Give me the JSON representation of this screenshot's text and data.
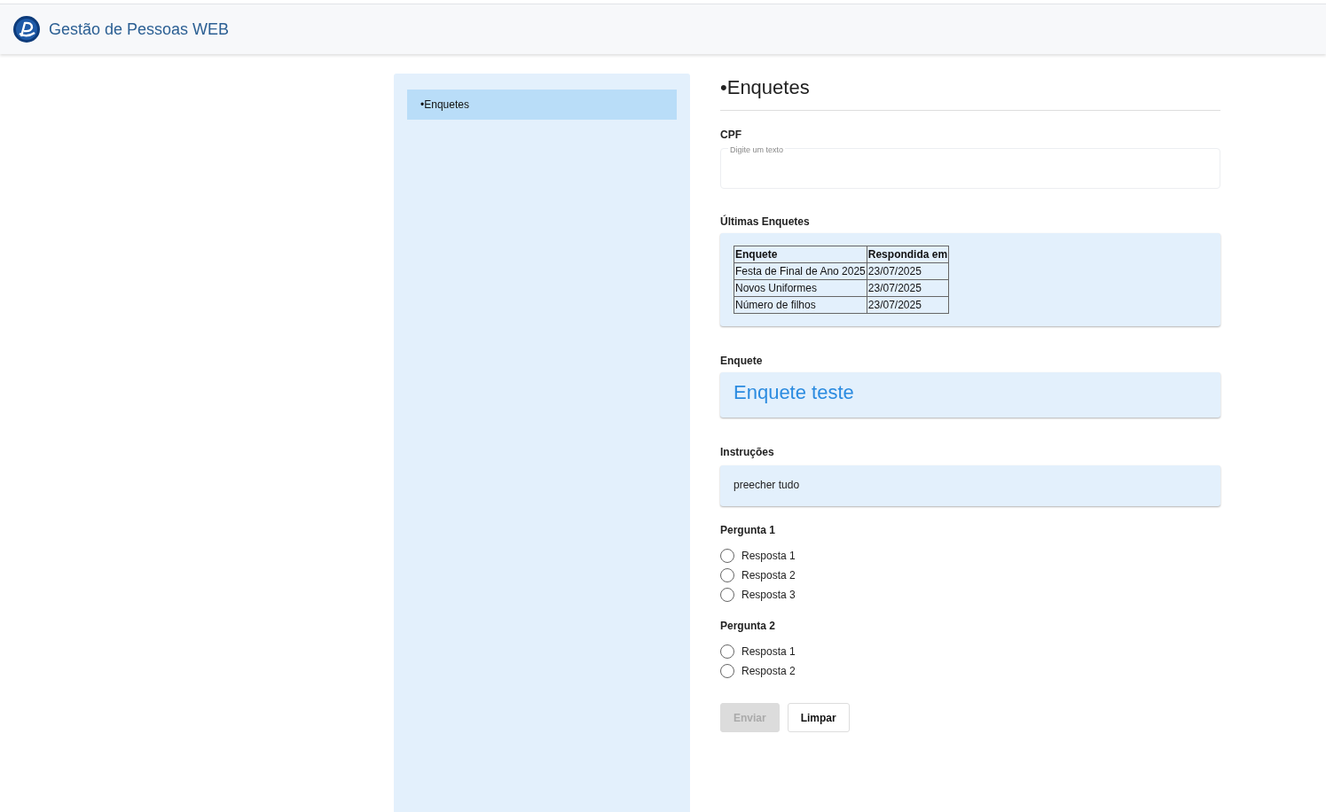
{
  "header": {
    "title": "Gestão de Pessoas WEB"
  },
  "sidebar": {
    "items": [
      {
        "label": "•Enquetes",
        "selected": true
      }
    ]
  },
  "page_title": "•Enquetes",
  "cpf": {
    "label": "CPF",
    "placeholder": "Digite um texto"
  },
  "recent": {
    "label": "Últimas Enquetes",
    "columns": [
      "Enquete",
      "Respondida em"
    ],
    "rows": [
      [
        "Festa de Final de Ano 2025",
        "23/07/2025"
      ],
      [
        "Novos Uniformes",
        "23/07/2025"
      ],
      [
        "Número de filhos",
        "23/07/2025"
      ]
    ]
  },
  "survey": {
    "label": "Enquete",
    "value": "Enquete teste"
  },
  "instructions": {
    "label": "Instruções",
    "value": "preecher tudo"
  },
  "questions": [
    {
      "label": "Pergunta 1",
      "options": [
        {
          "label": "Resposta 1",
          "selected": false
        },
        {
          "label": "Resposta 2",
          "selected": false
        },
        {
          "label": "Resposta 3",
          "selected": false
        }
      ]
    },
    {
      "label": "Pergunta 2",
      "options": [
        {
          "label": "Resposta 1",
          "selected": false
        },
        {
          "label": "Resposta 2",
          "selected": false
        }
      ]
    }
  ],
  "buttons": [
    {
      "label": "Enviar",
      "disabled": true
    },
    {
      "label": "Limpar",
      "disabled": false
    }
  ]
}
